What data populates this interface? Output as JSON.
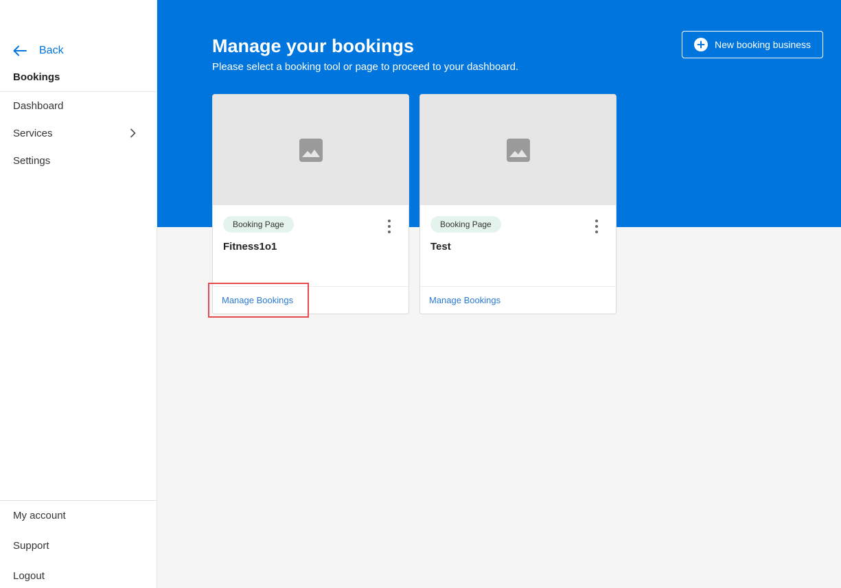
{
  "sidebar": {
    "back_label": "Back",
    "section_title": "Bookings",
    "items": [
      {
        "label": "Dashboard"
      },
      {
        "label": "Services",
        "has_chevron": true
      },
      {
        "label": "Settings"
      }
    ],
    "bottom_items": [
      {
        "label": "My account"
      },
      {
        "label": "Support"
      },
      {
        "label": "Logout"
      }
    ]
  },
  "header": {
    "title": "Manage your bookings",
    "subtitle": "Please select a booking tool or page to proceed to your dashboard.",
    "new_button_label": "New booking business"
  },
  "cards": [
    {
      "badge": "Booking Page",
      "name": "Fitness1o1",
      "action": "Manage Bookings"
    },
    {
      "badge": "Booking Page",
      "name": "Test",
      "action": "Manage Bookings"
    }
  ],
  "colors": {
    "accent": "#0075dd",
    "badge_bg": "#e4f3eb",
    "link": "#2a7ad5",
    "highlight": "#e5484d"
  },
  "icons": {
    "back": "arrow-left-icon",
    "chevron": "chevron-right-icon",
    "add": "plus-circle-icon",
    "placeholder": "image-placeholder-icon",
    "menu": "kebab-menu-icon"
  }
}
